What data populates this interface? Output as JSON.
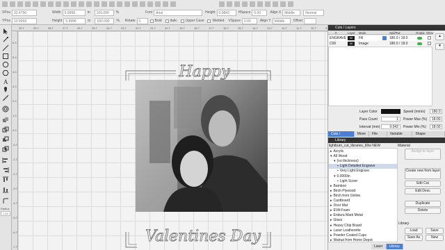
{
  "toolbar": {
    "xpos_label": "XPos",
    "xpos_value": "22.4756",
    "ypos_label": "YPos",
    "ypos_value": "10.9993",
    "width_label": "Width",
    "width_value": "5.9958",
    "height_label": "Height",
    "height_value": "5.9996",
    "scale_x": "100.000",
    "scale_y": "100.000",
    "unit": "in",
    "pct": "%",
    "rotate_label": "Rotate",
    "rotate_value": "0",
    "font_label": "Font",
    "font_value": "Arial",
    "fheight_label": "Height",
    "fheight_value": "0.9843",
    "hspace_label": "HSpace",
    "hspace_value": "0.00",
    "vspace_label": "VSpace",
    "vspace_value": "0.00",
    "bold": "Bold",
    "italic": "Italic",
    "upper": "Upper Case",
    "welded": "Welded",
    "alignx_label": "Align X",
    "alignx_value": "Middle",
    "aligny_label": "Align Y",
    "aligny_value": "Middle",
    "normal": "Normal",
    "offset_label": "Offset"
  },
  "ruler": {
    "top": [
      "30.7",
      "29.7",
      "28.7",
      "27.7",
      "26.7",
      "25.7",
      "24.7",
      "23.7",
      "22.7",
      "21.7",
      "20.7",
      "19.7",
      "18.7",
      "17.7",
      "16.7",
      "15.7",
      "14.7",
      "13.7",
      "12.7",
      "11.7",
      "10.7",
      "9.7"
    ],
    "left": [
      "6.3",
      "5.3",
      "4.3",
      "3.3",
      "2.3",
      "1.3",
      "0.3",
      "-0.7",
      "-1.7",
      "-2.7",
      "-3.7",
      "-4.7",
      "-5.7",
      "-6.7",
      "-7.7"
    ]
  },
  "design": {
    "top_text": "Happy",
    "bottom_text": "Valentines Day"
  },
  "cuts_panel": {
    "title": "Cuts / Layers",
    "headers": [
      "#",
      "Layer",
      "Mode",
      "Spd/Pwr",
      "Output",
      "Show"
    ],
    "rows": [
      {
        "name": "ENGRAVE",
        "num": "00",
        "mode": "Fill",
        "spd": "180.0 / 18.0",
        "color": "#1a1a1a"
      },
      {
        "name": "C00",
        "num": "00",
        "mode": "Image",
        "spd": "180.0 / 18.0",
        "color": "#1a1a1a"
      }
    ],
    "layer_color_label": "Layer Color",
    "speed_label": "Speed (mm/s)",
    "speed_value": "180.0",
    "pass_label": "Pass Count",
    "pass_value": "1",
    "pmax_label": "Power Max (%)",
    "pmax_value": "18.00",
    "interval_label": "Interval (mm)",
    "interval_value": "0.042",
    "pmin_label": "Power Min (%)",
    "pmin_value": "18.00"
  },
  "tabs": [
    "Cuts / Layers",
    "Move",
    "File List",
    "Variable Text",
    "Shape Properties"
  ],
  "library": {
    "title": "Library",
    "file": "lightburn_cut_libraries_60w NEW",
    "material_label": "Material",
    "items": [
      {
        "text": "Acrylic",
        "indent": 0,
        "marker": "▸"
      },
      {
        "text": "All Wood",
        "indent": 0,
        "marker": "▾"
      },
      {
        "text": "(no thickness)",
        "indent": 1,
        "marker": "▾"
      },
      {
        "text": "Light Detailed Engrave",
        "indent": 2,
        "marker": "",
        "selected": true
      },
      {
        "text": "Very Light Engrave",
        "indent": 2,
        "marker": ""
      },
      {
        "text": "0.0000in",
        "indent": 1,
        "marker": "▾"
      },
      {
        "text": "Light Score",
        "indent": 2,
        "marker": ""
      },
      {
        "text": "Bamboo",
        "indent": 0,
        "marker": "▸"
      },
      {
        "text": "Birch Plywood",
        "indent": 0,
        "marker": "▸"
      },
      {
        "text": "Birch from Online",
        "indent": 0,
        "marker": "▸"
      },
      {
        "text": "Cardboard",
        "indent": 0,
        "marker": "▸"
      },
      {
        "text": "Door Mat",
        "indent": 0,
        "marker": "▸"
      },
      {
        "text": "EVA Foam",
        "indent": 0,
        "marker": "▸"
      },
      {
        "text": "Endura Mark Metal",
        "indent": 0,
        "marker": "▸"
      },
      {
        "text": "Glass",
        "indent": 0,
        "marker": "▸"
      },
      {
        "text": "Heavy Chip Board",
        "indent": 0,
        "marker": "▸"
      },
      {
        "text": "Laser Leatherette",
        "indent": 0,
        "marker": "▸"
      },
      {
        "text": "Powder Coated Cups",
        "indent": 0,
        "marker": "▸"
      },
      {
        "text": "Walnut from Home Depot",
        "indent": 0,
        "marker": "▸"
      }
    ],
    "assign": "Assign to layer",
    "create": "Create new from layer",
    "edit_cut": "Edit Cut",
    "edit_desc": "Edit Desc",
    "duplicate": "Duplicate",
    "delete": "Delete",
    "library_label": "Library",
    "load": "Load",
    "save": "Save",
    "save_as": "Save As",
    "new": "New"
  },
  "bottom_tabs": [
    "Laser",
    "Library"
  ]
}
